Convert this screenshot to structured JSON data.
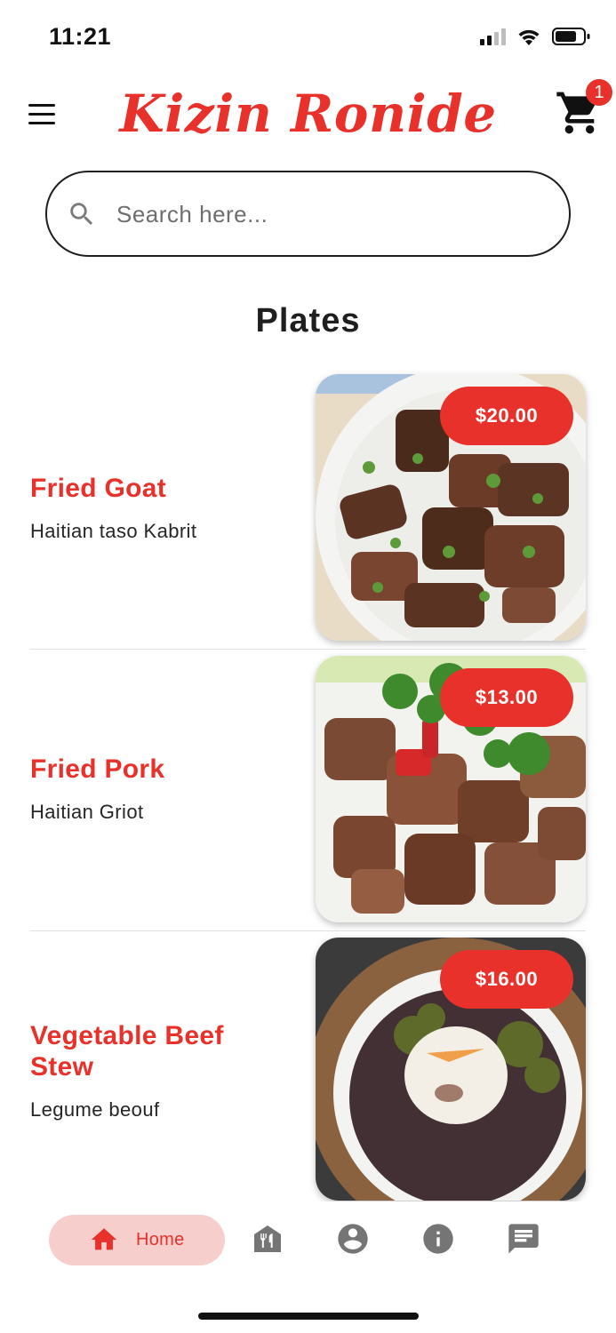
{
  "status_bar": {
    "time": "11:21"
  },
  "header": {
    "title": "Kizin Ronide",
    "cart_count": "1",
    "icons": [
      "menu-icon",
      "cart-icon"
    ]
  },
  "search": {
    "placeholder": "Search here...",
    "value": ""
  },
  "section": {
    "title": "Plates"
  },
  "plates": [
    {
      "name": "Fried Goat",
      "description": "Haitian taso Kabrit",
      "price": "$20.00"
    },
    {
      "name": "Fried Pork",
      "description": "Haitian Griot",
      "price": "$13.00"
    },
    {
      "name": "Vegetable Beef Stew",
      "description": "Legume beouf",
      "price": "$16.00"
    }
  ],
  "bottom_nav": {
    "home_label": "Home",
    "items": [
      "home-icon",
      "restaurant-icon",
      "account-icon",
      "info-icon",
      "chat-icon"
    ]
  },
  "colors": {
    "accent": "#e8312a",
    "home_pill": "#f6cfcd",
    "nav_icon": "#757575"
  }
}
